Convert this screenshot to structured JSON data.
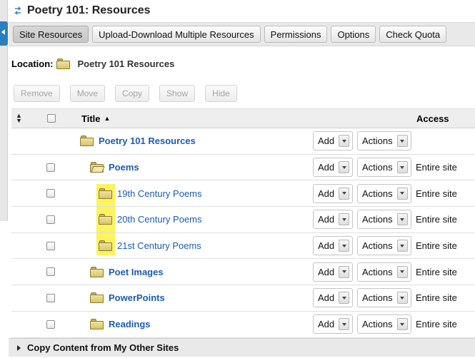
{
  "header": {
    "title": "Poetry 101: Resources"
  },
  "toolbar": {
    "buttons": [
      {
        "label": "Site Resources"
      },
      {
        "label": "Upload-Download Multiple Resources"
      },
      {
        "label": "Permissions"
      },
      {
        "label": "Options"
      },
      {
        "label": "Check Quota"
      }
    ]
  },
  "location": {
    "label": "Location:",
    "value": "Poetry 101 Resources"
  },
  "actions": {
    "remove": "Remove",
    "move": "Move",
    "copy": "Copy",
    "show": "Show",
    "hide": "Hide"
  },
  "table": {
    "title_header": "Title",
    "access_header": "Access",
    "add_label": "Add",
    "actions_label": "Actions",
    "rows": [
      {
        "name": "Poetry 101 Resources",
        "access": ""
      },
      {
        "name": "Poems",
        "access": "Entire site"
      },
      {
        "name": "19th Century Poems",
        "access": "Entire site"
      },
      {
        "name": "20th Century Poems",
        "access": "Entire site"
      },
      {
        "name": "21st Century Poems",
        "access": "Entire site"
      },
      {
        "name": "Poet Images",
        "access": "Entire site"
      },
      {
        "name": "PowerPoints",
        "access": "Entire site"
      },
      {
        "name": "Readings",
        "access": "Entire site"
      }
    ]
  },
  "footer": {
    "label": "Copy Content from My Other Sites"
  },
  "colors": {
    "link": "#1a5cb8",
    "accent": "#2a7fc1",
    "highlight": "#fbf45c"
  }
}
